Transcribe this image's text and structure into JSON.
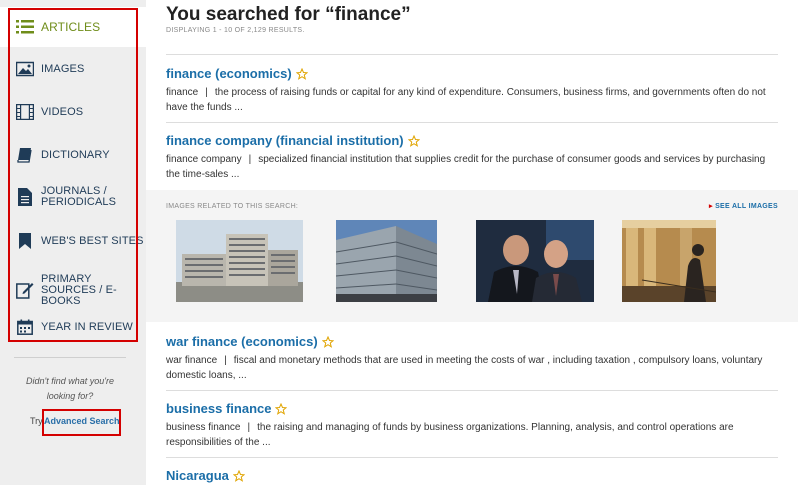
{
  "sidebar": {
    "items": [
      {
        "label": "ARTICLES",
        "icon": "list-icon"
      },
      {
        "label": "IMAGES",
        "icon": "image-icon"
      },
      {
        "label": "VIDEOS",
        "icon": "film-icon"
      },
      {
        "label": "DICTIONARY",
        "icon": "book-icon"
      },
      {
        "label": "JOURNALS / PERIODICALS",
        "icon": "document-icon"
      },
      {
        "label": "WEB'S BEST SITES",
        "icon": "bookmark-icon"
      },
      {
        "label": "PRIMARY SOURCES / E-BOOKS",
        "icon": "edit-icon"
      },
      {
        "label": "YEAR IN REVIEW",
        "icon": "calendar-icon"
      }
    ],
    "help_text": "Didn't find what you're looking for?",
    "try_label": "Try",
    "advanced_search_label": "Advanced Search"
  },
  "header": {
    "title": "You searched for “finance”",
    "subtitle": "DISPLAYING 1 - 10 OF 2,129 RESULTS."
  },
  "results": [
    {
      "title": "finance (economics)",
      "term": "finance",
      "separator": "|",
      "description": "the process of raising funds or capital for any kind of expenditure. Consumers, business firms, and governments often do not have the funds ..."
    },
    {
      "title": "finance company (financial institution)",
      "term": "finance company",
      "separator": "|",
      "description": "specialized financial institution that supplies credit  for the purchase of consumer goods and services by purchasing the time-sales ..."
    },
    {
      "title": "war finance (economics)",
      "term": "war finance",
      "separator": "|",
      "description": "fiscal and monetary methods that are used in meeting the costs of war , including taxation , compulsory loans, voluntary domestic loans, ..."
    },
    {
      "title": "business finance",
      "term": "business finance",
      "separator": "|",
      "description": "the raising and managing of funds by business organizations. Planning, analysis, and control operations are responsibilities of the ..."
    },
    {
      "title": "Nicaragua",
      "term": "",
      "separator": "",
      "description": ""
    }
  ],
  "images_strip": {
    "label": "IMAGES RELATED TO THIS SEARCH:",
    "see_all": "SEE ALL IMAGES",
    "thumbnails": [
      "office-building-photo",
      "glass-building-photo",
      "officials-meeting-photo",
      "statue-hall-photo"
    ]
  },
  "colors": {
    "accent_red": "#d40000",
    "link_blue": "#1b6ea8",
    "active_green": "#6f8d1a",
    "star_gold": "#e0a400"
  }
}
